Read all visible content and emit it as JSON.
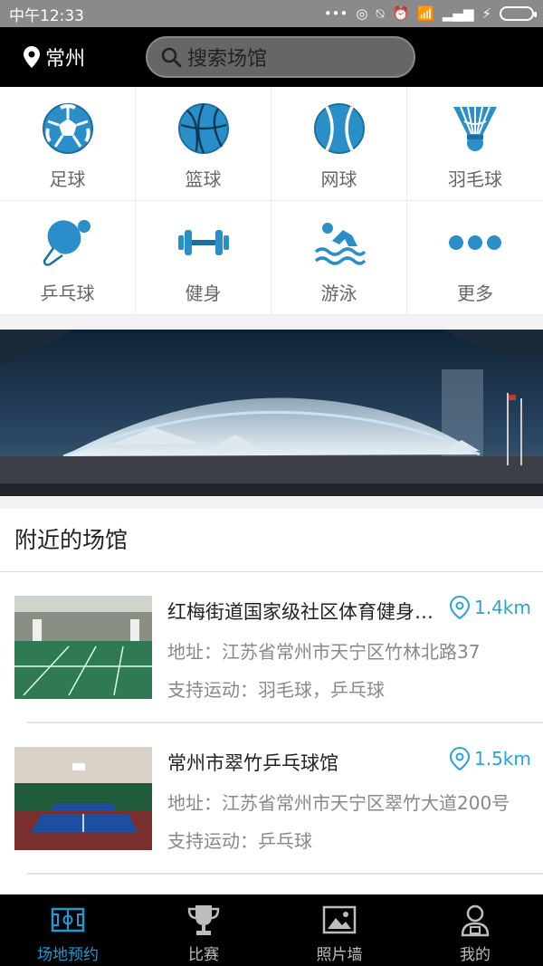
{
  "status_bar": {
    "carrier_time": "中午12:33"
  },
  "header": {
    "city": "常州",
    "search_placeholder": "搜索场馆"
  },
  "sports": [
    {
      "label": "足球",
      "icon": "soccer-ball-icon"
    },
    {
      "label": "篮球",
      "icon": "basketball-icon"
    },
    {
      "label": "网球",
      "icon": "tennis-ball-icon"
    },
    {
      "label": "羽毛球",
      "icon": "shuttlecock-icon"
    },
    {
      "label": "乒乓球",
      "icon": "ping-pong-icon"
    },
    {
      "label": "健身",
      "icon": "dumbbell-icon"
    },
    {
      "label": "游泳",
      "icon": "swimmer-icon"
    },
    {
      "label": "更多",
      "icon": "more-dots-icon"
    }
  ],
  "nearby": {
    "title": "附近的场馆",
    "venues": [
      {
        "name": "红梅街道国家级社区体育健身中心",
        "distance": "1.4km",
        "address": "地址：江苏省常州市天宁区竹林北路37",
        "sports": "支持运动：羽毛球，乒乓球"
      },
      {
        "name": "常州市翠竹乒乓球馆",
        "distance": "1.5km",
        "address": "地址：江苏省常州市天宁区翠竹大道200号",
        "sports": "支持运动：乒乓球"
      }
    ]
  },
  "tabs": [
    {
      "label": "场地预约",
      "icon": "court-icon",
      "active": true
    },
    {
      "label": "比赛",
      "icon": "trophy-icon",
      "active": false
    },
    {
      "label": "照片墙",
      "icon": "photo-icon",
      "active": false
    },
    {
      "label": "我的",
      "icon": "user-icon",
      "active": false
    }
  ],
  "colors": {
    "accent": "#2aa3d9",
    "tab_active": "#1e9ad6",
    "top_bar": "#000000"
  }
}
